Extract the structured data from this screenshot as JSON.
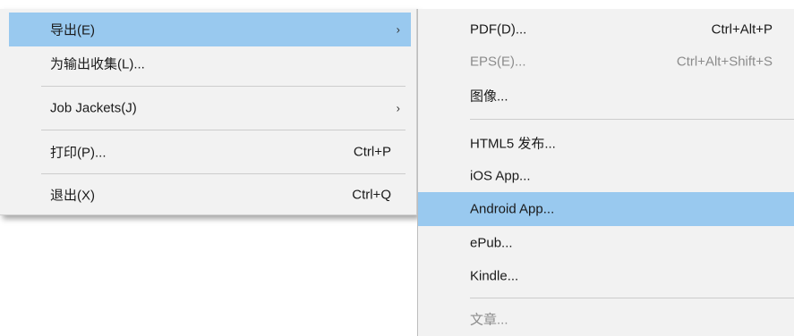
{
  "main_menu": {
    "items": [
      {
        "label": "导出(E)",
        "submenu_arrow": "›"
      },
      {
        "label": "为输出收集(L)..."
      },
      {
        "label": "Job Jackets(J)",
        "submenu_arrow": "›"
      },
      {
        "label": "打印(P)...",
        "shortcut": "Ctrl+P"
      },
      {
        "label": "退出(X)",
        "shortcut": "Ctrl+Q"
      }
    ]
  },
  "export_submenu": {
    "items": [
      {
        "label": "PDF(D)...",
        "shortcut": "Ctrl+Alt+P"
      },
      {
        "label": "EPS(E)...",
        "shortcut": "Ctrl+Alt+Shift+S"
      },
      {
        "label": "图像..."
      },
      {
        "label": "HTML5 发布..."
      },
      {
        "label": "iOS App..."
      },
      {
        "label": "Android App..."
      },
      {
        "label": "ePub..."
      },
      {
        "label": "Kindle..."
      },
      {
        "label": "文章..."
      }
    ]
  },
  "colors": {
    "menu_background": "#f2f2f2",
    "highlight": "#99c9ef",
    "disabled_text": "#8c8c8c",
    "separator": "#cdcdcd"
  }
}
